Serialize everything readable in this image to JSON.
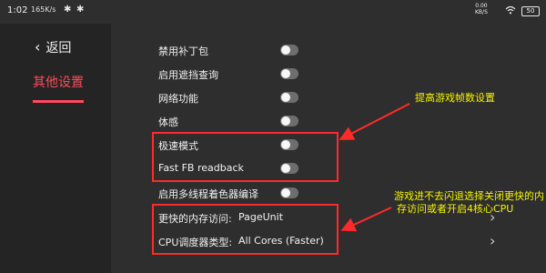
{
  "status": {
    "time": "1:02",
    "network": "165K/s",
    "speed_top": "0.00",
    "speed_bottom": "KB/S",
    "battery": "50"
  },
  "sidebar": {
    "back_label": "返回",
    "active_item": "其他设置"
  },
  "settings": [
    {
      "label": "禁用补丁包",
      "control": "toggle",
      "on": false
    },
    {
      "label": "启用遮挡查询",
      "control": "toggle",
      "on": false
    },
    {
      "label": "网络功能",
      "control": "toggle",
      "on": false
    },
    {
      "label": "体感",
      "control": "toggle",
      "on": false
    },
    {
      "label": "极速模式",
      "control": "toggle",
      "on": false
    },
    {
      "label": "Fast FB readback",
      "control": "toggle",
      "on": false
    },
    {
      "label": "启用多线程着色器编译",
      "control": "toggle",
      "on": false
    },
    {
      "label": "更快的内存访问:",
      "control": "select",
      "value": "PageUnit"
    },
    {
      "label": "CPU调度器类型:",
      "control": "select",
      "value": "All Cores (Faster)"
    }
  ],
  "annotations": {
    "note1": "提高游戏帧数设置",
    "note2_line1": "游戏进不去闪退选择关闭更快的内",
    "note2_line2": "存访问或者开启4核心CPU"
  },
  "colors": {
    "background": "#2e2e2e",
    "sidebar": "#242424",
    "accent": "#ff4a5a",
    "annotation_box": "#ff2a2a",
    "annotation_text": "#f5f500"
  }
}
